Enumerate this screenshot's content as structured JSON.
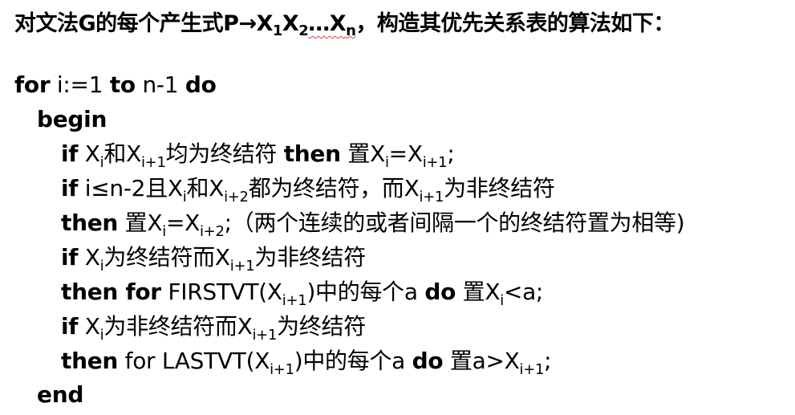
{
  "title": {
    "part1": "对文法G的每个产生式P→X",
    "sub1": "1",
    "part2": "X",
    "sub2": "2",
    "part3": "…X",
    "subn": "n",
    "part4": "，构造其优先关系表的算法如下："
  },
  "code": {
    "for_kw": "for",
    "for_text": " i:=1 ",
    "to_kw": "to",
    "to_text": " n-1 ",
    "do_kw": "do",
    "begin_kw": "begin",
    "end_kw": "end",
    "line1": {
      "kw": "if",
      "t1": " X",
      "s1": "i",
      "t2": "和X",
      "s2": "i+1",
      "t3": "均为终结符 ",
      "kw2": "then",
      "t4": " 置X",
      "s3": "i",
      "t5": "=X",
      "s4": "i+1",
      "t6": ";"
    },
    "line2": {
      "kw": "if",
      "t1": " i≤n-2且X",
      "s1": "i",
      "t2": "和X",
      "s2": "i+2",
      "t3": "都为终结符，而X",
      "s3": "i+1",
      "t4": "为非终结符"
    },
    "line3": {
      "kw": "then",
      "t1": " 置X",
      "s1": "i",
      "t2": "=X",
      "s2": "i+2",
      "t3": ";（两个连续的或者间隔一个的终结符置为相等)"
    },
    "line4": {
      "kw": "if",
      "t1": " X",
      "s1": "i",
      "t2": "为终结符而X",
      "s2": "i+1",
      "t3": "为非终结符"
    },
    "line5": {
      "kw": "then for",
      "t1": " FIRSTVT(X",
      "s1": "i+1",
      "t2": ")中的每个a ",
      "kw2": "do",
      "t3": " 置X",
      "s2": "i",
      "t4": "<a;"
    },
    "line6": {
      "kw": "if",
      "t1": " X",
      "s1": "i",
      "t2": "为非终结符而X",
      "s2": "i+1",
      "t3": "为终结符"
    },
    "line7": {
      "kw": "then",
      "t1": " for LASTVT(X",
      "s1": "i+1",
      "t2": ")中的每个a ",
      "kw2": "do",
      "t3": " 置a>X",
      "s2": "i+1",
      "t4": ";"
    }
  }
}
